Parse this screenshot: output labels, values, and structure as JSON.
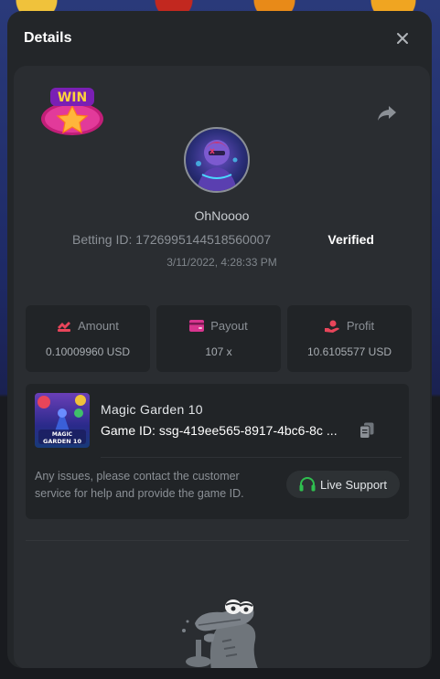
{
  "modal": {
    "title": "Details"
  },
  "badge": {
    "text": "WIN"
  },
  "user": {
    "name": "OhNoooo"
  },
  "bet": {
    "betting_id": "Betting ID: 1726995144518560007",
    "verified": "Verified",
    "datetime": "3/11/2022, 4:28:33 PM"
  },
  "stats": {
    "amount": {
      "label": "Amount",
      "value": "0.10009960 USD",
      "icon": "coins-icon",
      "color": "#e8455a"
    },
    "payout": {
      "label": "Payout",
      "value": "107 x",
      "icon": "wallet-icon",
      "color": "#d9358f"
    },
    "profit": {
      "label": "Profit",
      "value": "10.6105577 USD",
      "icon": "hand-coin-icon",
      "color": "#e8455a"
    }
  },
  "game": {
    "name": "Magic Garden 10",
    "id_label": "Game ID:",
    "id_value": "ssg-419ee565-8917-4bc6-8c",
    "thumb_text": "MAGIC GARDEN 10"
  },
  "support": {
    "text": "Any issues, please contact the customer service for help and provide the game ID.",
    "button_label": "Live Support",
    "icon_color": "#2fbf4f"
  }
}
